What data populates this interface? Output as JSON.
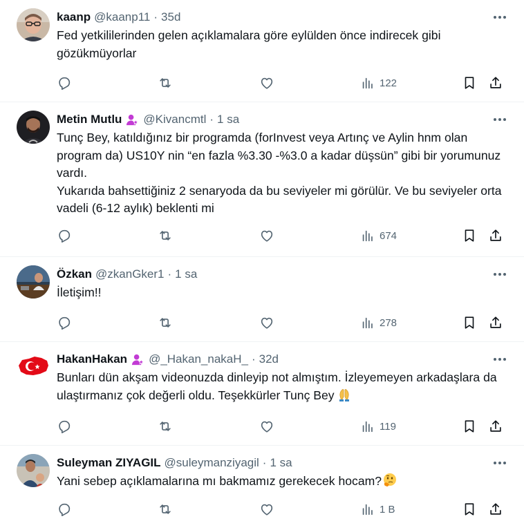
{
  "tweets": [
    {
      "name": "kaanp",
      "handle": "@kaanp11",
      "time": "35d",
      "verified_badge": false,
      "text": "Fed yetkililerinden gelen açıklamalara göre eylülden önce indirecek gibi gözükmüyorlar",
      "views": "122",
      "avatar": "person-with-glasses-avatar"
    },
    {
      "name": "Metin Mutlu",
      "handle": "@Kivancmtl",
      "time": "1 sa",
      "verified_badge": true,
      "text": "Tunç Bey, katıldığınız bir programda (forInvest veya Artınç ve Aylin hnm olan program da) US10Y nin “en fazla %3.30 -%3.0 a kadar düşsün” gibi bir yorumunuz vardı.\nYukarıda bahsettiğiniz 2 senaryoda da bu seviyeler mi görülür. Ve bu seviyeler orta vadeli (6-12 aylık) beklenti mi",
      "views": "674",
      "avatar": "bearded-man-avatar"
    },
    {
      "name": "Özkan",
      "handle": "@zkanGker1",
      "time": "1 sa",
      "verified_badge": false,
      "text": "İletişim!!",
      "views": "278",
      "avatar": "man-at-desk-avatar"
    },
    {
      "name": "HakanHakan",
      "handle": "@_Hakan_nakaH_",
      "time": "32d",
      "verified_badge": true,
      "text": "Bunları dün akşam videonuzda dinleyip not almıştım. İzleyemeyen arkadaşlara da ulaştırmanız çok değerli oldu. Teşekkürler Tunç Bey",
      "emoji": "folded-hands-emoji",
      "views": "119",
      "avatar": "turkish-flag-map-avatar"
    },
    {
      "name": "Suleyman ZIYAGIL",
      "handle": "@suleymanziyagil",
      "time": "1 sa",
      "verified_badge": false,
      "text": "Yani sebep açıklamalarına mı bakmamız gerekecek hocam?",
      "emoji": "thinking-face-emoji",
      "views": "1 B",
      "avatar": "man-with-child-avatar"
    }
  ],
  "separator": "·",
  "colors": {
    "text": "#0f1419",
    "muted": "#536471",
    "badge": "#c23bd4",
    "border": "#eff3f4"
  }
}
